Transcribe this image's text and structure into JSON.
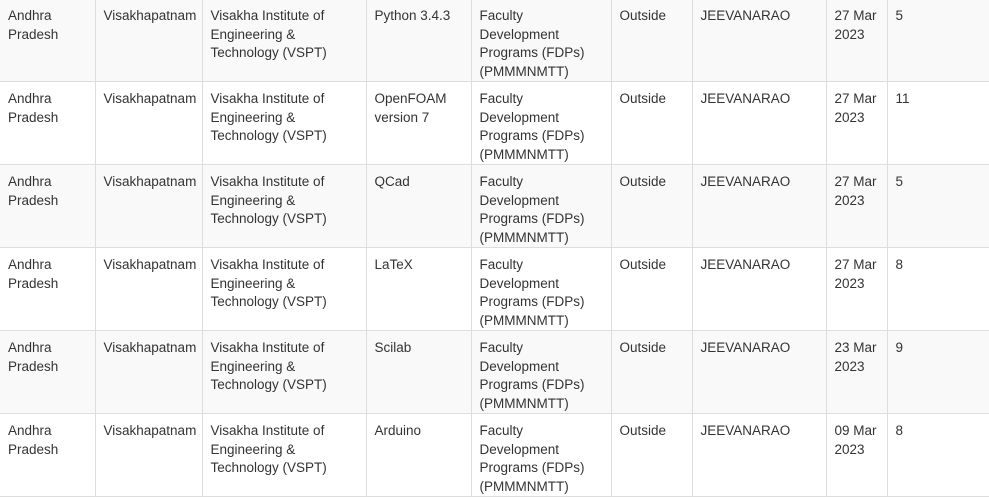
{
  "table": {
    "rows": [
      {
        "state": "Andhra Pradesh",
        "city": "Visakhapatnam",
        "institute": "Visakha Institute of Engineering & Technology (VSPT)",
        "foss": "Python 3.4.3",
        "type": "Faculty Development Programs (FDPs) (PMMMNMTT)",
        "department": "Outside",
        "coordinator": "JEEVANARAO",
        "date": "27 Mar 2023",
        "participants": "5"
      },
      {
        "state": "Andhra Pradesh",
        "city": "Visakhapatnam",
        "institute": "Visakha Institute of Engineering & Technology (VSPT)",
        "foss": "OpenFOAM version 7",
        "type": "Faculty Development Programs (FDPs) (PMMMNMTT)",
        "department": "Outside",
        "coordinator": "JEEVANARAO",
        "date": "27 Mar 2023",
        "participants": "11"
      },
      {
        "state": "Andhra Pradesh",
        "city": "Visakhapatnam",
        "institute": "Visakha Institute of Engineering & Technology (VSPT)",
        "foss": "QCad",
        "type": "Faculty Development Programs (FDPs) (PMMMNMTT)",
        "department": "Outside",
        "coordinator": "JEEVANARAO",
        "date": "27 Mar 2023",
        "participants": "5"
      },
      {
        "state": "Andhra Pradesh",
        "city": "Visakhapatnam",
        "institute": "Visakha Institute of Engineering & Technology (VSPT)",
        "foss": "LaTeX",
        "type": "Faculty Development Programs (FDPs) (PMMMNMTT)",
        "department": "Outside",
        "coordinator": "JEEVANARAO",
        "date": "27 Mar 2023",
        "participants": "8"
      },
      {
        "state": "Andhra Pradesh",
        "city": "Visakhapatnam",
        "institute": "Visakha Institute of Engineering & Technology (VSPT)",
        "foss": "Scilab",
        "type": "Faculty Development Programs (FDPs) (PMMMNMTT)",
        "department": "Outside",
        "coordinator": "JEEVANARAO",
        "date": "23 Mar 2023",
        "participants": "9"
      },
      {
        "state": "Andhra Pradesh",
        "city": "Visakhapatnam",
        "institute": "Visakha Institute of Engineering & Technology (VSPT)",
        "foss": "Arduino",
        "type": "Faculty Development Programs (FDPs) (PMMMNMTT)",
        "department": "Outside",
        "coordinator": "JEEVANARAO",
        "date": "09 Mar 2023",
        "participants": "8"
      }
    ]
  }
}
